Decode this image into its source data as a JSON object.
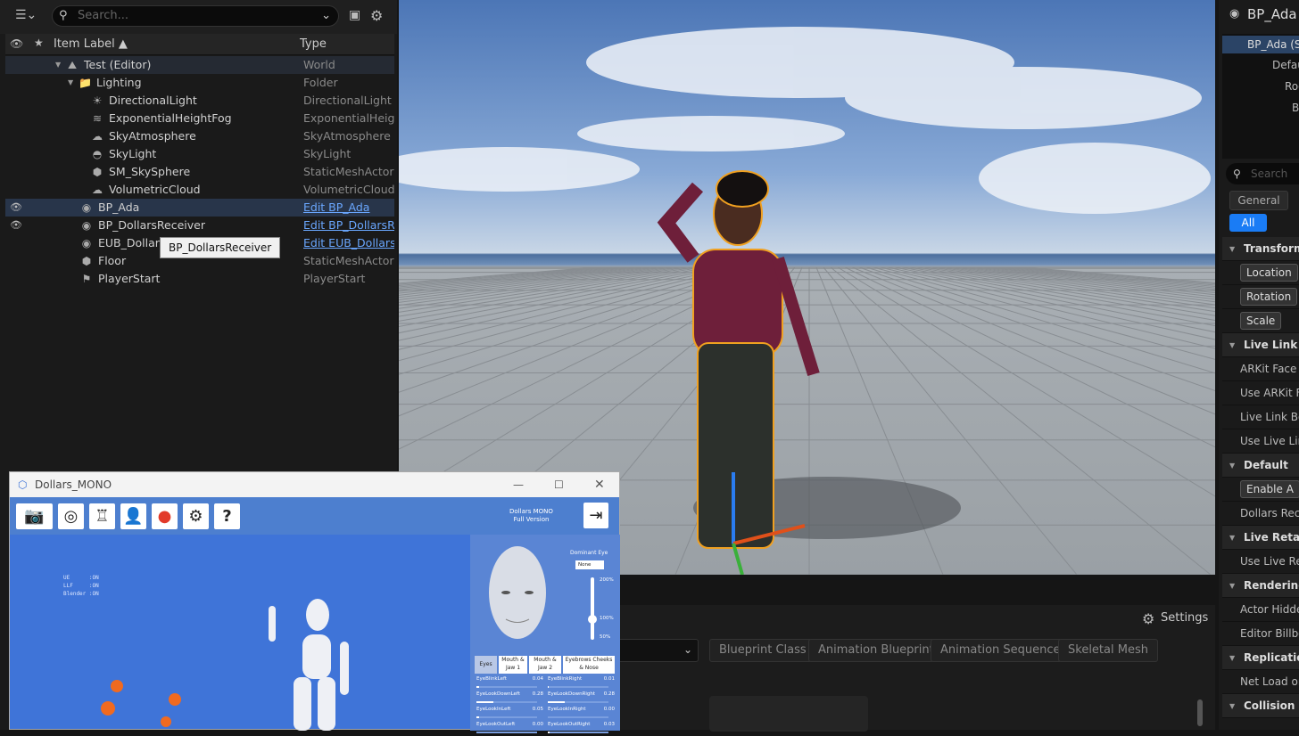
{
  "outliner": {
    "search_placeholder": "Search...",
    "col_label": "Item Label ▲",
    "col_type": "Type",
    "rows": [
      {
        "label": "Test (Editor)",
        "type": "World",
        "icon": "world-icon"
      },
      {
        "label": "Lighting",
        "type": "Folder",
        "icon": "folder-icon"
      },
      {
        "label": "DirectionalLight",
        "type": "DirectionalLight",
        "icon": "sun-icon"
      },
      {
        "label": "ExponentialHeightFog",
        "type": "ExponentialHeight",
        "icon": "fog-icon"
      },
      {
        "label": "SkyAtmosphere",
        "type": "SkyAtmosphere",
        "icon": "atmosphere-icon"
      },
      {
        "label": "SkyLight",
        "type": "SkyLight",
        "icon": "skylight-icon"
      },
      {
        "label": "SM_SkySphere",
        "type": "StaticMeshActor",
        "icon": "mesh-icon"
      },
      {
        "label": "VolumetricCloud",
        "type": "VolumetricCloud",
        "icon": "cloud-icon"
      },
      {
        "label": "BP_Ada",
        "type": "Edit BP_Ada",
        "icon": "blueprint-icon"
      },
      {
        "label": "BP_DollarsReceiver",
        "type": "Edit BP_DollarsRe",
        "icon": "blueprint-icon"
      },
      {
        "label": "EUB_DollarsT",
        "type": "Edit EUB_DollarsT",
        "icon": "blueprint-icon"
      },
      {
        "label": "Floor",
        "type": "StaticMeshActor",
        "icon": "mesh-icon"
      },
      {
        "label": "PlayerStart",
        "type": "PlayerStart",
        "icon": "playerstart-icon"
      }
    ],
    "tooltip": "BP_DollarsReceiver"
  },
  "details": {
    "title": "BP_Ada",
    "tree": [
      "BP_Ada (S",
      "Defau",
      "Roo",
      "B"
    ],
    "search_placeholder": "Search",
    "filter_general": "General",
    "filter_all": "All",
    "rows": [
      {
        "t": "cat",
        "l": "Transform"
      },
      {
        "t": "btn",
        "l": "Location"
      },
      {
        "t": "btn",
        "l": "Rotation"
      },
      {
        "t": "btn",
        "l": "Scale"
      },
      {
        "t": "cat",
        "l": "Live Link"
      },
      {
        "t": "p",
        "l": "ARKit Face S"
      },
      {
        "t": "p",
        "l": "Use ARKit Fa"
      },
      {
        "t": "p",
        "l": "Live Link Boc"
      },
      {
        "t": "p",
        "l": "Use Live Link"
      },
      {
        "t": "cat",
        "l": "Default"
      },
      {
        "t": "btn",
        "l": "Enable A"
      },
      {
        "t": "p",
        "l": "Dollars Recei"
      },
      {
        "t": "cat",
        "l": "Live Retarget"
      },
      {
        "t": "p",
        "l": "Use Live Reta"
      },
      {
        "t": "cat",
        "l": "Rendering"
      },
      {
        "t": "p",
        "l": "Actor Hidden"
      },
      {
        "t": "p",
        "l": "Editor Billboa"
      },
      {
        "t": "cat",
        "l": "Replication"
      },
      {
        "t": "p",
        "l": "Net Load on"
      },
      {
        "t": "cat",
        "l": "Collision"
      }
    ]
  },
  "content_browser": {
    "settings": "Settings",
    "filters": [
      "Blueprint Class",
      "Animation Blueprint",
      "Animation Sequence",
      "Skeletal Mesh"
    ]
  },
  "mono": {
    "title": "Dollars_MONO",
    "edition_line1": "Dollars MONO",
    "edition_line2": "Full Version",
    "toolbar_icons": [
      "camera-icon",
      "aperture-icon",
      "desk-icon",
      "person-icon",
      "record-icon",
      "gear-icon",
      "help-icon"
    ],
    "status": [
      "UE      :ON",
      "LLF     :ON",
      "Blender :ON"
    ],
    "dominant_eye_label": "Dominant Eye",
    "dominant_eye_value": "None",
    "scale_ticks": [
      "200%",
      "100%",
      "50%"
    ],
    "scale_value_percent": 100,
    "tabs": [
      "Eyes",
      "Mouth & Jaw 1",
      "Mouth & Jaw 2",
      "Eyebrows Cheeks & Nose"
    ],
    "blendshapes": [
      {
        "name": "EyeBlinkLeft",
        "value": "0.04"
      },
      {
        "name": "EyeBlinkRight",
        "value": "0.01"
      },
      {
        "name": "EyeLookDownLeft",
        "value": "0.28"
      },
      {
        "name": "EyeLookDownRight",
        "value": "0.28"
      },
      {
        "name": "EyeLookInLeft",
        "value": "0.05"
      },
      {
        "name": "EyeLookInRight",
        "value": "0.00"
      },
      {
        "name": "EyeLookOutLeft",
        "value": "0.00"
      },
      {
        "name": "EyeLookOutRight",
        "value": "0.03"
      }
    ]
  },
  "colors": {
    "accent": "#1a7cf5",
    "link": "#6aa7ff",
    "mono_blue": "#3f74d8",
    "selection_outline": "#f0a020"
  }
}
